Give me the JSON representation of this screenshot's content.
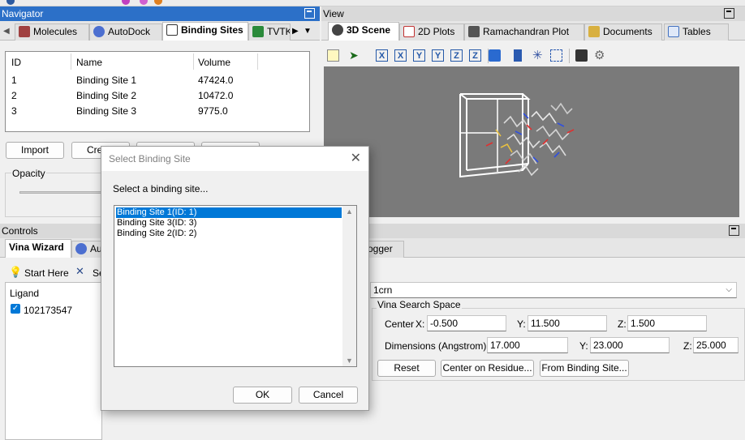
{
  "navigator": {
    "title": "Navigator",
    "tabs": [
      "Molecules",
      "AutoDock",
      "Binding Sites",
      "TVTK"
    ],
    "table": {
      "headers": [
        "ID",
        "Name",
        "Volume"
      ],
      "rows": [
        [
          "1",
          "Binding Site 1",
          "47424.0"
        ],
        [
          "2",
          "Binding Site 2",
          "10472.0"
        ],
        [
          "3",
          "Binding Site 3",
          "9775.0"
        ]
      ]
    },
    "import_label": "Import",
    "create_label": "Cre",
    "opacity_label": "Opacity"
  },
  "view": {
    "title": "View",
    "tabs": [
      "3D Scene",
      "2D Plots",
      "Ramachandran Plot",
      "Documents",
      "Tables"
    ],
    "axis_buttons": [
      "X",
      "X",
      "Y",
      "Y",
      "Z",
      "Z"
    ]
  },
  "controls": {
    "title": "Controls",
    "tabs": [
      "Vina Wizard",
      "Au",
      "ogger"
    ],
    "start_here": "Start Here",
    "se_label": "Se",
    "ligand_label": "Ligand",
    "ligand_item": "102173547",
    "receptor_value": "1crn",
    "vina_group": "Vina Search Space",
    "center_label": "Center",
    "x_label": "X:",
    "y_label": "Y:",
    "z_label": "Z:",
    "center_x": "-0.500",
    "center_y": "11.500",
    "center_z": "1.500",
    "dimensions_label": "Dimensions (Angstrom) X:",
    "dim_x": "17.000",
    "dim_y": "23.000",
    "dim_z": "25.000",
    "reset_label": "Reset",
    "center_residue_label": "Center on Residue...",
    "from_binding_label": "From Binding Site..."
  },
  "dialog": {
    "title": "Select Binding Site",
    "prompt": "Select a binding site...",
    "items": [
      "Binding Site 1(ID: 1)",
      "Binding Site 3(ID: 3)",
      "Binding Site 2(ID: 2)"
    ],
    "ok_label": "OK",
    "cancel_label": "Cancel"
  },
  "colors": {
    "title_active": "#2c70c8",
    "selection": "#0078d7",
    "scene_bg": "#7a7a7a"
  }
}
